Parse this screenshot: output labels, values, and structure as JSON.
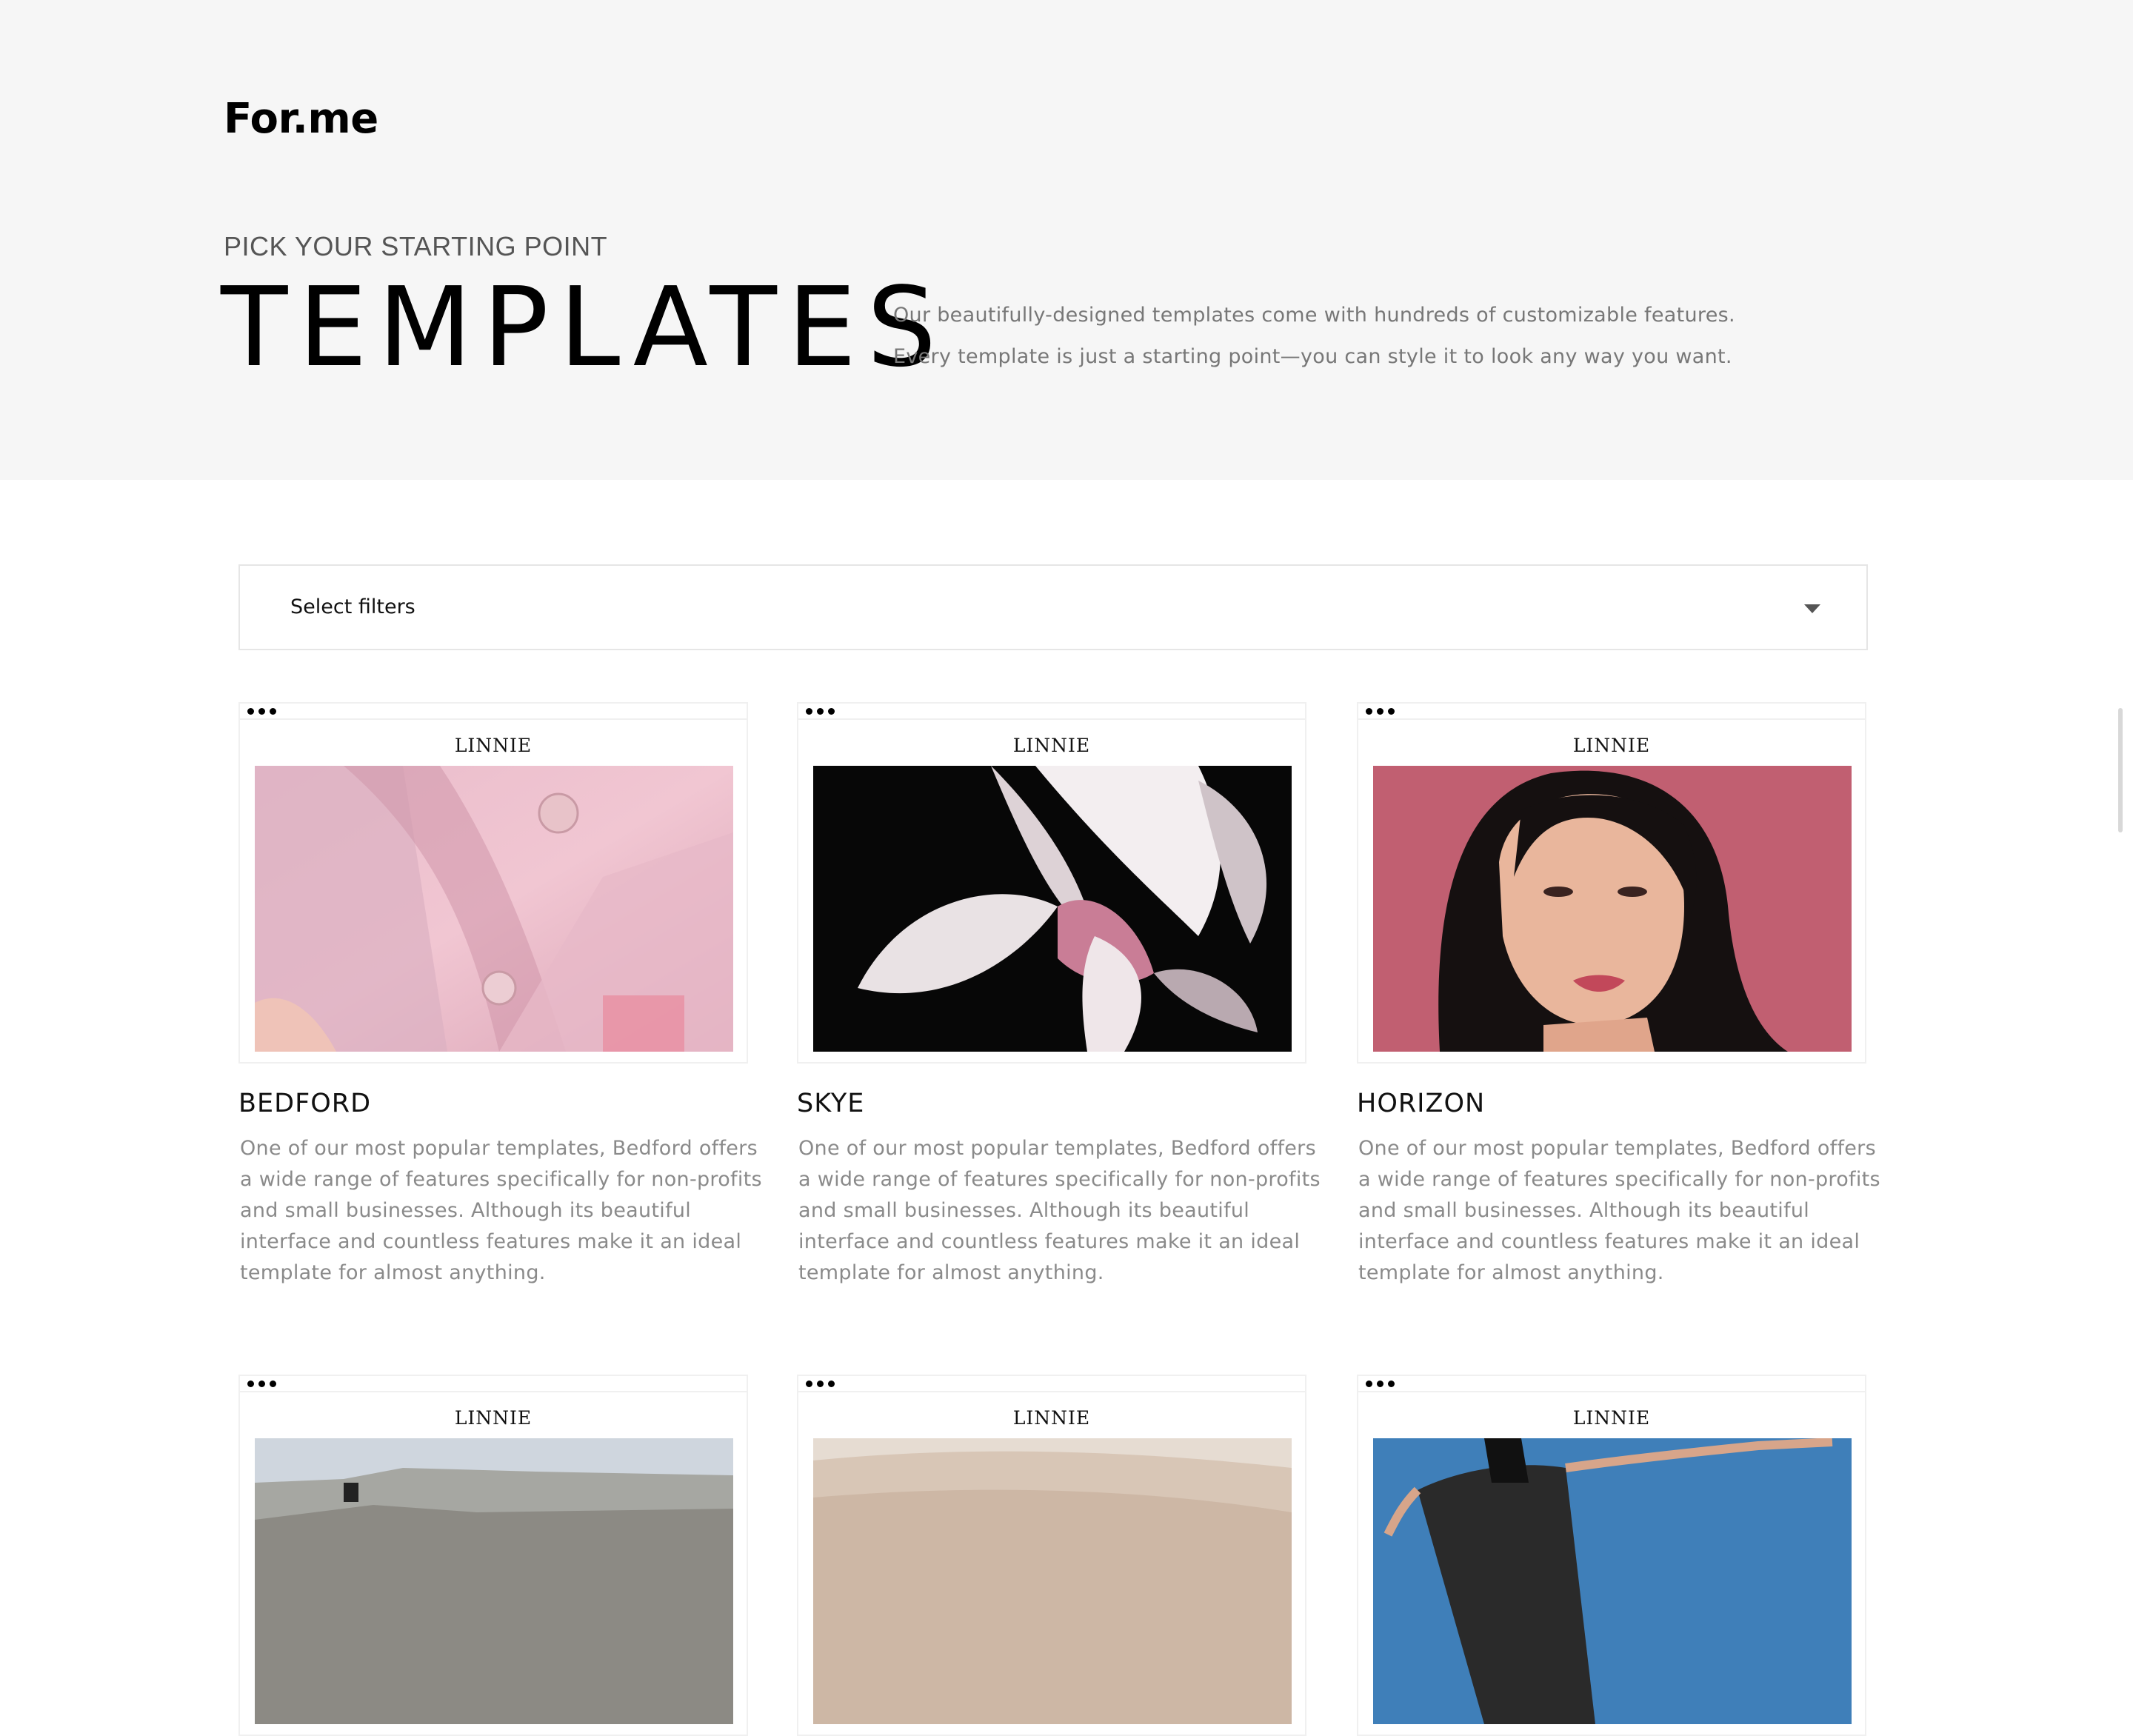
{
  "header": {
    "logo": "For.me",
    "eyebrow": "PICK YOUR STARTING POINT",
    "title": "TEMPLATES",
    "description": [
      "Our beautifully-designed templates come with hundreds of customizable features.",
      "Every template is just a starting point—you can style it to look any way you want."
    ]
  },
  "filter": {
    "label": "Select filters",
    "icon": "chevron-down-icon"
  },
  "templates": [
    {
      "name": "BEDFORD",
      "preview_brand": "LINNIE",
      "description": [
        "One of our most popular templates, Bedford offers",
        "a wide range of features specifically for non-profits",
        "and small businesses. Although its beautiful",
        "interface and countless features make it an ideal",
        "template for almost anything."
      ]
    },
    {
      "name": "SKYE",
      "preview_brand": "LINNIE",
      "description": [
        "One of our most popular templates, Bedford offers",
        "a wide range of features specifically for non-profits",
        "and small businesses. Although its beautiful",
        "interface and countless features make it an ideal",
        "template for almost anything."
      ]
    },
    {
      "name": "HORIZON",
      "preview_brand": "LINNIE",
      "description": [
        "One of our most popular templates, Bedford offers",
        "a wide range of features specifically for non-profits",
        "and small businesses. Although its beautiful",
        "interface and countless features make it an ideal",
        "template for almost anything."
      ]
    },
    {
      "preview_brand": "LINNIE"
    },
    {
      "preview_brand": "LINNIE"
    },
    {
      "preview_brand": "LINNIE"
    }
  ]
}
